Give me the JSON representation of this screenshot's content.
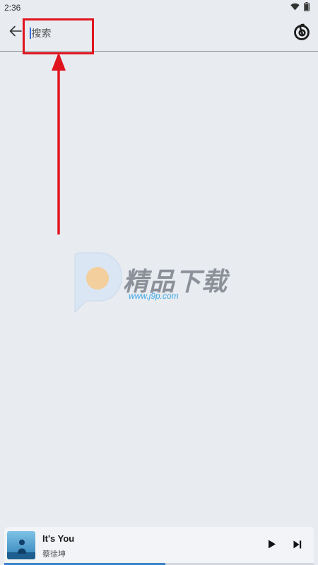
{
  "status_bar": {
    "time": "2:36",
    "icons": [
      "wifi-icon",
      "battery-icon"
    ]
  },
  "search_bar": {
    "back_icon": "arrow-left-icon",
    "placeholder": "搜索",
    "brand_icon": "netease-music-icon"
  },
  "watermark": {
    "title": "精品下载",
    "url": "www.j9p.com"
  },
  "player": {
    "title": "It's You",
    "artist": "蔡徐坤",
    "play_icon": "play-icon",
    "next_icon": "skip-next-icon",
    "progress": 0.52
  },
  "colors": {
    "annotation": "#e0141e",
    "accent": "#3a83c9",
    "background": "#e8ebf0"
  }
}
